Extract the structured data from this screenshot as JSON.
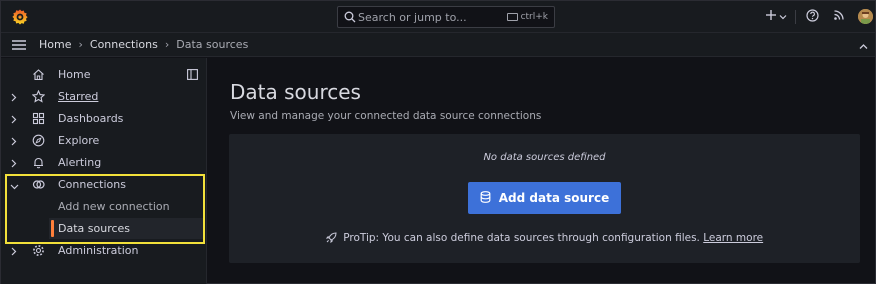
{
  "colors": {
    "accent": "#3d71d9",
    "active_bar": "#ff7f3a",
    "highlight": "#f2e03a"
  },
  "topbar": {
    "logo_icon": "grafana-logo-icon",
    "search": {
      "placeholder": "Search or jump to...",
      "shortcut": "ctrl+k"
    },
    "icons": [
      "plus-icon",
      "chevron-down-icon",
      "help-icon",
      "rss-icon",
      "avatar"
    ]
  },
  "breadcrumb": {
    "items": [
      "Home",
      "Connections",
      "Data sources"
    ]
  },
  "sidebar": {
    "items": [
      {
        "label": "Home",
        "icon": "home-icon"
      },
      {
        "label": "Starred",
        "icon": "star-icon"
      },
      {
        "label": "Dashboards",
        "icon": "dashboards-icon"
      },
      {
        "label": "Explore",
        "icon": "compass-icon"
      },
      {
        "label": "Alerting",
        "icon": "bell-icon"
      },
      {
        "label": "Connections",
        "icon": "connections-icon"
      },
      {
        "label": "Administration",
        "icon": "cog-icon"
      }
    ],
    "connections_children": [
      "Add new connection",
      "Data sources"
    ]
  },
  "main": {
    "title": "Data sources",
    "subtitle": "View and manage your connected data source connections",
    "empty_message": "No data sources defined",
    "add_button": "Add data source",
    "protip_text": "ProTip: You can also define data sources through configuration files.",
    "protip_link": "Learn more"
  }
}
